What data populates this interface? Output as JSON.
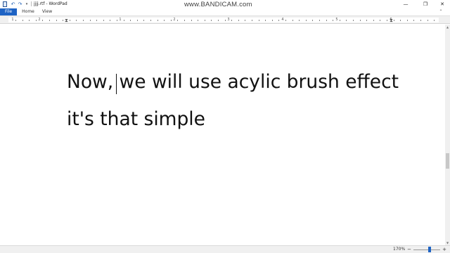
{
  "window": {
    "title": "jjjj.rtf - WordPad",
    "minimize_glyph": "—",
    "maximize_glyph": "❐",
    "close_glyph": "✕"
  },
  "quick_access": {
    "undo_glyph": "↶",
    "redo_glyph": "↷",
    "dropdown_glyph": "▾"
  },
  "watermark": "www.BANDICAM.com",
  "ribbon": {
    "tabs": [
      "File",
      "Home",
      "View"
    ],
    "active_tab": "File",
    "active_color": "#1e63c4",
    "collapse_glyph": "⌃"
  },
  "ruler": {
    "labels": [
      "1",
      "2",
      "1",
      "2",
      "3",
      "4",
      "5",
      "6"
    ],
    "indent_glyph": "⧗",
    "right_glyph": "⧗"
  },
  "document": {
    "lines": [
      "Now, we will use acylic brush effect",
      "it's that simple"
    ]
  },
  "scrollbar": {
    "up_glyph": "▲",
    "down_glyph": "▼"
  },
  "statusbar": {
    "zoom_level": "170%",
    "zoom_out_glyph": "−",
    "zoom_in_glyph": "+"
  }
}
